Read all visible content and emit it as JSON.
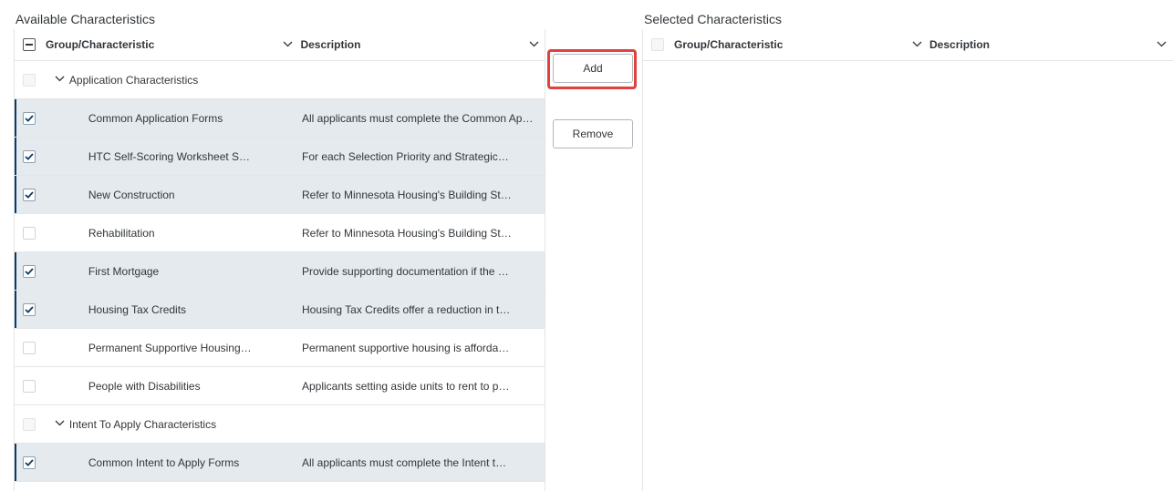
{
  "available": {
    "title": "Available Characteristics",
    "headers": {
      "group": "Group/Characteristic",
      "description": "Description"
    },
    "rows": [
      {
        "kind": "group",
        "label": "Application Characteristics",
        "description": "",
        "checked": false
      },
      {
        "kind": "item",
        "label": "Common Application Forms",
        "description": "All applicants must complete the Common Application Forms",
        "checked": true
      },
      {
        "kind": "item",
        "label": "HTC Self-Scoring Worksheet S…",
        "description": "For each Selection Priority and Strategic…",
        "checked": true
      },
      {
        "kind": "item",
        "label": "New Construction",
        "description": "Refer to Minnesota Housing's Building St…",
        "checked": true
      },
      {
        "kind": "item",
        "label": "Rehabilitation",
        "description": "Refer to Minnesota Housing's Building St…",
        "checked": false
      },
      {
        "kind": "item",
        "label": "First Mortgage",
        "description": "Provide supporting documentation if the …",
        "checked": true
      },
      {
        "kind": "item",
        "label": "Housing Tax Credits",
        "description": "Housing Tax Credits offer a reduction in t…",
        "checked": true
      },
      {
        "kind": "item",
        "label": "Permanent Supportive Housing…",
        "description": "Permanent supportive housing is afforda…",
        "checked": false
      },
      {
        "kind": "item",
        "label": "People with Disabilities",
        "description": "Applicants setting aside units to rent to p…",
        "checked": false
      },
      {
        "kind": "group",
        "label": "Intent To Apply Characteristics",
        "description": "",
        "checked": false
      },
      {
        "kind": "item",
        "label": "Common Intent to Apply Forms",
        "description": "All applicants must complete the Intent t…",
        "checked": true
      }
    ]
  },
  "selected": {
    "title": "Selected Characteristics",
    "headers": {
      "group": "Group/Characteristic",
      "description": "Description"
    }
  },
  "actions": {
    "add_label": "Add",
    "remove_label": "Remove"
  },
  "icons": {
    "expand": "chevron-down-icon",
    "check": "check-icon",
    "select_all": "partial-select-icon"
  },
  "colors": {
    "selected_row_bg": "#e5eaef",
    "selected_row_accent": "#0a3a66",
    "highlight": "#e0413f"
  }
}
